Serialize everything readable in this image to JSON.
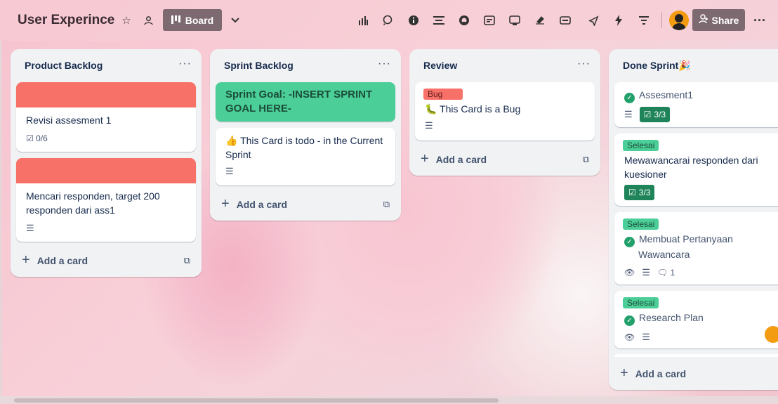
{
  "header": {
    "title": "User Experince",
    "view_label": "Board",
    "share_label": "Share",
    "icons": [
      "star-icon",
      "workspace-icon",
      "chart-icon",
      "chat-icon",
      "info-icon",
      "list-icon",
      "github-icon",
      "card-icon",
      "mirror-icon",
      "plugin-icon",
      "table-icon",
      "send-icon",
      "automation-icon",
      "filter-icon"
    ]
  },
  "lists": [
    {
      "title": "Product Backlog",
      "cards": [
        {
          "cover_color": "#f87168",
          "text": "Revisi assesment 1",
          "checklist": "0/6"
        },
        {
          "cover_color": "#f87168",
          "text": "Mencari responden, target 200 responden dari ass1"
        }
      ],
      "add_label": "Add a card"
    },
    {
      "title": "Sprint Backlog",
      "cards": [
        {
          "text": "Sprint Goal: -INSERT SPRINT GOAL HERE-",
          "color": "#4bce97"
        },
        {
          "text": "👍 This Card is todo - in the Current Sprint"
        }
      ],
      "add_label": "Add a card"
    },
    {
      "title": "Review",
      "cards": [
        {
          "label": "Bug",
          "label_color": "#f87168",
          "text": "🐛 This Card is a Bug"
        }
      ],
      "add_label": "Add a card"
    },
    {
      "title": "Done Sprint🎉",
      "cards": [
        {
          "text": "Assesment1",
          "checklist": "3/3"
        },
        {
          "label": "Selesai",
          "label_color": "#4bce97",
          "text": "Mewawancarai responden dari kuesioner",
          "checklist": "3/3"
        },
        {
          "label": "Selesai",
          "label_color": "#4bce97",
          "text": "Membuat Pertanyaan Wawancara",
          "comments": "1"
        },
        {
          "label": "Selesai",
          "label_color": "#4bce97",
          "text": "Research Plan"
        }
      ],
      "add_label": "Add a card"
    }
  ]
}
